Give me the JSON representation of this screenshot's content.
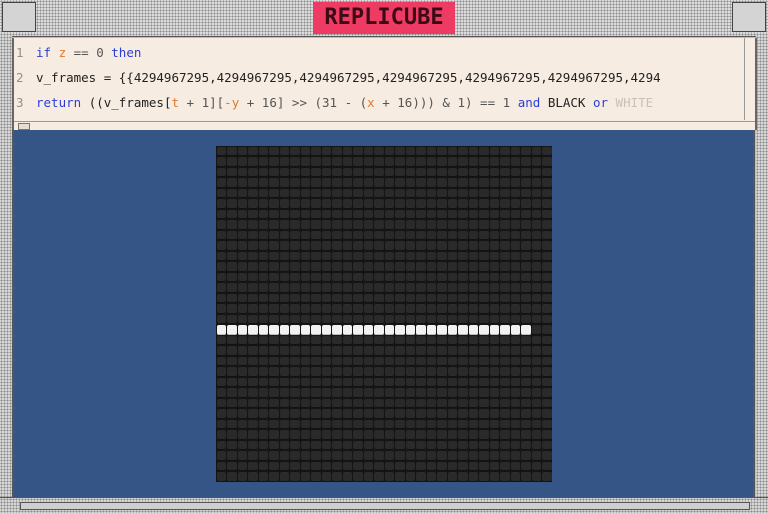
{
  "app": {
    "title": "REPLICUBE"
  },
  "editor": {
    "lines": [
      {
        "number": "1",
        "tokens": [
          {
            "t": "if ",
            "c": "kw"
          },
          {
            "t": "z",
            "c": "var"
          },
          {
            "t": " == 0 ",
            "c": "num"
          },
          {
            "t": "then",
            "c": "kw"
          }
        ]
      },
      {
        "number": "2",
        "tokens": [
          {
            "t": "  v_frames = {{4294967295,4294967295,4294967295,4294967295,4294967295,4294967295,4294",
            "c": "cst"
          }
        ]
      },
      {
        "number": "3",
        "tokens": [
          {
            "t": "  return ",
            "c": "kw"
          },
          {
            "t": "((v_frames[",
            "c": "cst"
          },
          {
            "t": "t",
            "c": "var"
          },
          {
            "t": " + 1][",
            "c": "num"
          },
          {
            "t": "-y",
            "c": "var"
          },
          {
            "t": " + 16] >> (31 - (",
            "c": "num"
          },
          {
            "t": "x",
            "c": "var"
          },
          {
            "t": " + 16))) & 1) == 1 ",
            "c": "num"
          },
          {
            "t": "and ",
            "c": "kw"
          },
          {
            "t": "BLACK ",
            "c": "cst"
          },
          {
            "t": "or ",
            "c": "kw"
          },
          {
            "t": "WHITE",
            "c": "pale"
          }
        ]
      }
    ]
  },
  "cube_view": {
    "grid_size": 32,
    "white_row": 17,
    "white_cols": [
      0,
      29
    ],
    "colors": {
      "background": "#345585",
      "black_cell": "#2a2a2a",
      "white_cell": "#f2f2f2"
    }
  }
}
